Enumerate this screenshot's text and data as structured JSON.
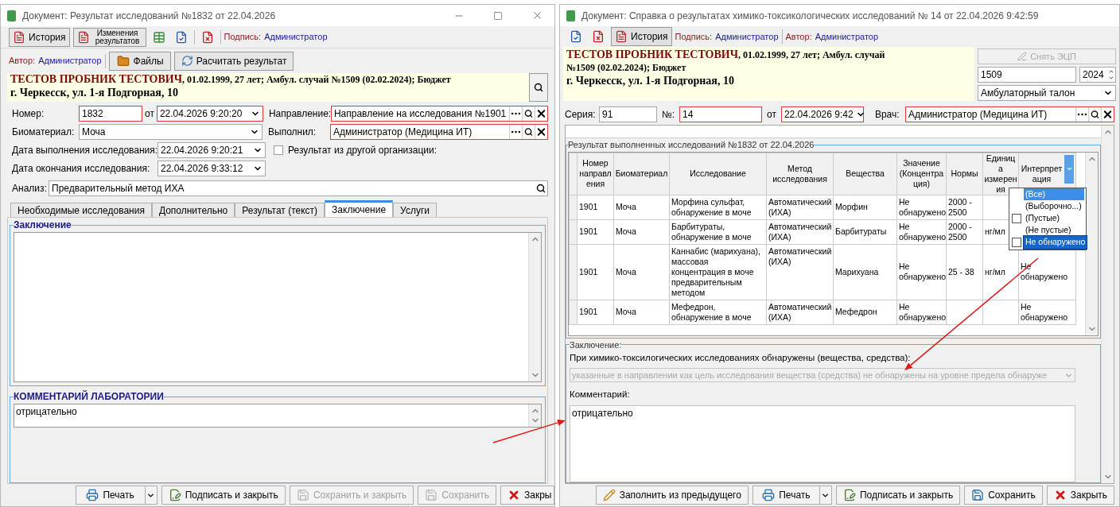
{
  "left": {
    "title": "Документ: Результат исследований №1832 от 22.04.2026",
    "toolbar": {
      "history": "История",
      "changes": "Изменения результатов",
      "signature_label": "Подпись:",
      "signature_value": "Администратор"
    },
    "row2": {
      "author_label": "Автор:",
      "author_value": "Администратор",
      "files": "Файлы",
      "calc": "Расчитать результат"
    },
    "patient": {
      "name": "ТЕСТОВ ПРОБНИК ТЕСТОВИЧ",
      "details": ", 01.02.1999, 27 лет; Амбул. случай №1509 (02.02.2024); Бюджет",
      "address": "г. Черкесск, ул. 1-я Подгорная, 10"
    },
    "form": {
      "number_label": "Номер:",
      "number": {
        "value": "1832",
        "required": true
      },
      "from_label": "от",
      "date": {
        "value": "22.04.2026 9:20:20",
        "required": true
      },
      "referral_label": "Направление:",
      "referral": {
        "value": "Направление на исследования №1901",
        "required": true
      },
      "biomaterial_label": "Биоматериал:",
      "biomaterial": {
        "value": "Моча",
        "required": false
      },
      "performer_label": "Выполнил:",
      "performer": {
        "value": "Администратор (Медицина ИТ)",
        "required": true
      },
      "done_label": "Дата выполнения исследования:",
      "done_date": {
        "value": "22.04.2026 9:20:21",
        "required": false
      },
      "external": {
        "label": "Результат из другой организации:",
        "checked": false
      },
      "end_label": "Дата окончания исследования:",
      "end_date": {
        "value": "22.04.2026 9:33:12",
        "required": false
      },
      "analysis_label": "Анализ:",
      "analysis": {
        "value": "Предварительный метод ИХА",
        "required": false
      }
    },
    "tabs": [
      {
        "label": "Необходимые исследования",
        "selected": false
      },
      {
        "label": "Дополнительно",
        "selected": false
      },
      {
        "label": "Результат (текст)",
        "selected": false
      },
      {
        "label": "Заключение",
        "selected": true
      },
      {
        "label": "Услуги",
        "selected": false
      }
    ],
    "conclusion": {
      "title": "Заключение"
    },
    "comment": {
      "title": "КОММЕНТАРИЙ ЛАБОРАТОРИИ",
      "value": "отрицательно"
    },
    "buttons": [
      {
        "kind": "print",
        "label": "Печать",
        "disabled": false
      },
      {
        "kind": "sign",
        "label": "Подписать и закрыть",
        "disabled": false
      },
      {
        "kind": "save",
        "label": "Сохранить и закрыть",
        "disabled": true
      },
      {
        "kind": "save",
        "label": "Сохранить",
        "disabled": true
      },
      {
        "kind": "close",
        "label": "Закры",
        "disabled": false
      }
    ]
  },
  "right": {
    "title": "Документ: Справка о результатах химико-токсикологических исследований № 14 от 22.04.2026 9:42:59",
    "toolbar": {
      "history": "История",
      "signature_label": "Подпись:",
      "signature_value": "Администратор",
      "author_label": "Автор:",
      "author_value": "Администратор"
    },
    "patient": {
      "name": "ТЕСТОВ ПРОБНИК ТЕСТОВИЧ",
      "details": ", 01.02.1999, 27 лет; Амбул. случай №1509 (02.02.2024); Бюджет",
      "address": "г. Черкесск, ул. 1-я Подгорная, 10"
    },
    "side": {
      "remove_signature": {
        "label": "Снять ЭЦП",
        "disabled": true
      },
      "case": "1509",
      "year": "2024",
      "case_type": "Амбулаторный талон"
    },
    "form": {
      "series_label": "Серия:",
      "series": {
        "value": "91",
        "required": false
      },
      "no_label": "№:",
      "no": {
        "value": "14",
        "required": true
      },
      "from_label": "от",
      "date": {
        "value": "22.04.2026 9:42",
        "required": true
      },
      "doctor_label": "Врач:",
      "doctor": {
        "value": "Администратор (Медицина ИТ)",
        "required": true
      }
    },
    "results": {
      "title": "Результат выполненных исследований №1832 от 22.04.2026",
      "columns": [
        "Номер направления",
        "Биоматериал",
        "Исследование",
        "Метод исследования",
        "Вещества",
        "Значение (Концентрация)",
        "Нормы",
        "Единица измерения",
        "Интерпретация"
      ],
      "rows": [
        [
          "1901",
          "Моча",
          "Морфина сульфат, обнаружение в моче",
          "Автоматический (ИХА)",
          "Морфин",
          "Не обнаружено",
          "2000 - 2500",
          null,
          null
        ],
        [
          "1901",
          "Моча",
          "Барбитураты, обнаружение в моче",
          "Автоматический (ИХА)",
          "Барбитураты",
          "Не обнаружено",
          "2000 - 2500",
          "нг/мл",
          null
        ],
        [
          "1901",
          "Моча",
          "Каннабис (марихуана), массовая концентрация в моче предварительным методом",
          "Автоматический (ИХА)",
          "Марихуана",
          "Не обнаружено",
          "25 - 38",
          "нг/мл",
          "Не обнаружено"
        ],
        [
          "1901",
          "Моча",
          "Мефедрон, обнаружение в моче",
          "Автоматический (ИХА)",
          "Мефедрон",
          "Не обнаружено",
          null,
          null,
          "Не обнаружено"
        ]
      ],
      "filter": [
        {
          "label": "(Все)",
          "kind": "plain",
          "selected": true,
          "hovered": false
        },
        {
          "label": "(Выборочно...)",
          "kind": "plain",
          "selected": false,
          "hovered": false
        },
        {
          "label": "(Пустые)",
          "kind": "checkbox",
          "checked": false,
          "selected": false,
          "hovered": false
        },
        {
          "label": "(Не пустые)",
          "kind": "plain",
          "selected": false,
          "hovered": false
        },
        {
          "label": "Не обнаружено",
          "kind": "checkbox",
          "checked": false,
          "selected": false,
          "hovered": true
        }
      ]
    },
    "conclusion": {
      "title": "Заключение:",
      "prompt": "При химико-токсилогических исследованиях обнаружены (вещества, средства):",
      "finding": {
        "value": "указанные в направлении как цель исследования вещества (средства) не обнаружены на уровне предела обнаруже",
        "disabled": true
      },
      "comment_label": "Комментарий:",
      "comment": "отрицательно"
    },
    "buttons": [
      {
        "kind": "fill",
        "label": "Заполнить из предыдущего",
        "disabled": false
      },
      {
        "kind": "print",
        "label": "Печать",
        "disabled": false
      },
      {
        "kind": "sign",
        "label": "Подписать и закрыть",
        "disabled": false
      },
      {
        "kind": "save",
        "label": "Сохранить",
        "disabled": false
      },
      {
        "kind": "close",
        "label": "Закрыть",
        "disabled": false
      }
    ]
  }
}
